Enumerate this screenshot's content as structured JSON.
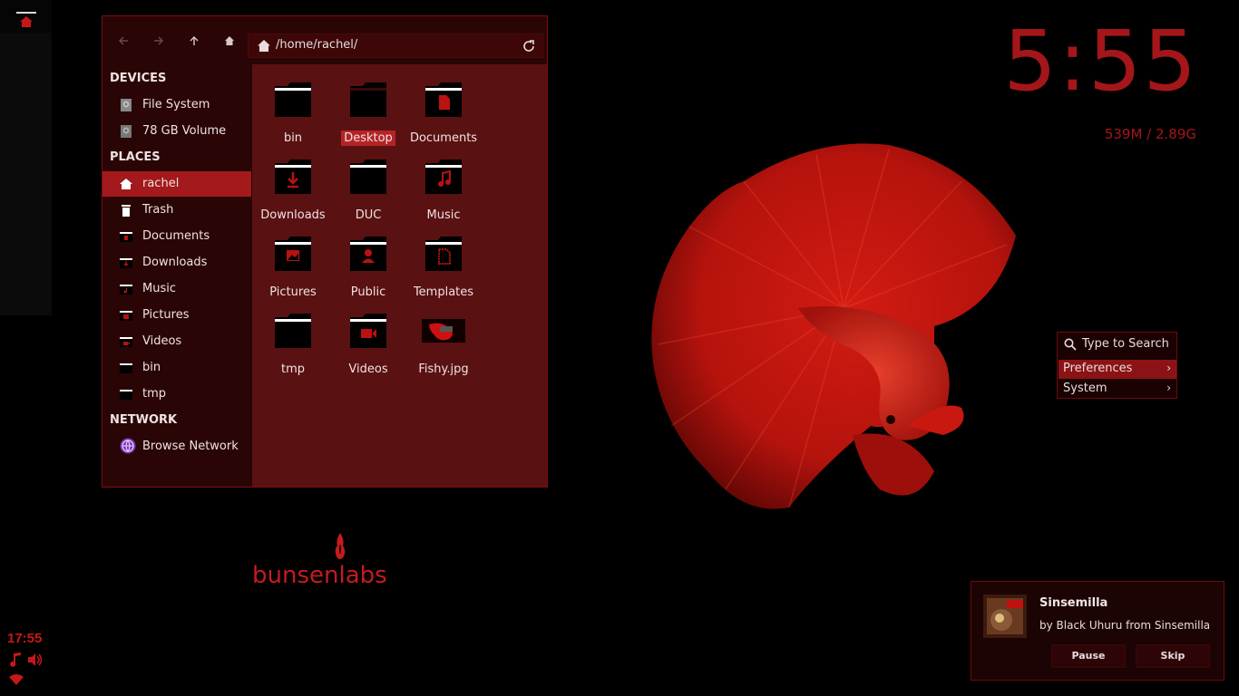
{
  "clock": {
    "time": "5:55",
    "memory": "539M / 2.89G"
  },
  "tray": {
    "time": "17:55"
  },
  "brand": {
    "name": "bunsenlabs"
  },
  "file_manager": {
    "path": "/home/rachel/",
    "sidebar": {
      "devices_header": "DEVICES",
      "devices": [
        "File System",
        "78 GB Volume"
      ],
      "places_header": "PLACES",
      "places": [
        "rachel",
        "Trash",
        "Documents",
        "Downloads",
        "Music",
        "Pictures",
        "Videos",
        "bin",
        "tmp"
      ],
      "network_header": "NETWORK",
      "network": [
        "Browse Network"
      ]
    },
    "files": [
      "bin",
      "Desktop",
      "Documents",
      "Downloads",
      "DUC",
      "Music",
      "Pictures",
      "Public",
      "Templates",
      "tmp",
      "Videos",
      "Fishy.jpg"
    ]
  },
  "menu": {
    "search_placeholder": "Type to Search",
    "items": [
      "Preferences",
      "System"
    ],
    "arrow": "›"
  },
  "notification": {
    "title": "Sinsemilla",
    "subtitle": "by Black Uhuru from Sinsemilla",
    "pause": "Pause",
    "skip": "Skip"
  },
  "colors": {
    "accent": "#a4161a",
    "selection": "#b52325",
    "panel_bg": "#2a0506",
    "content_bg": "#5a1112"
  }
}
